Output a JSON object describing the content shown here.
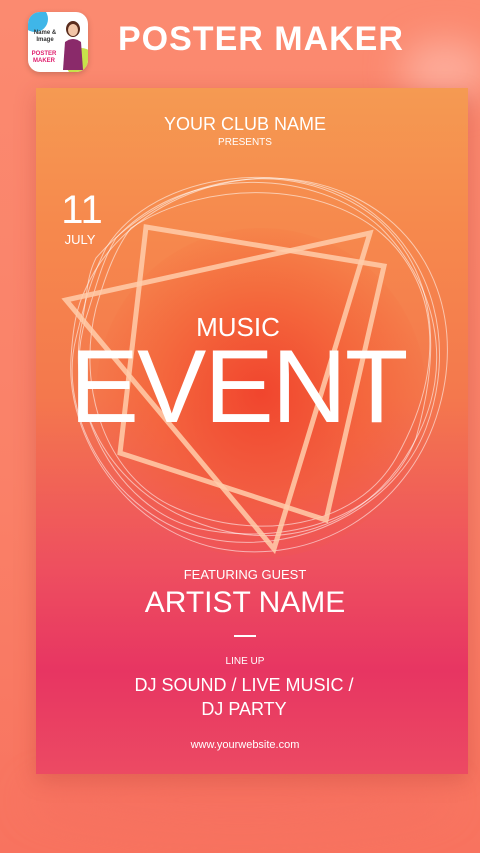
{
  "header": {
    "app_icon": {
      "name_image_text": "Name & Image",
      "poster_maker_text": "POSTER MAKER"
    },
    "title": "POSTER MAKER"
  },
  "poster": {
    "club_name": "YOUR CLUB NAME",
    "presents": "PRESENTS",
    "date_day": "11",
    "date_month": "JULY",
    "music": "MUSIC",
    "event": "EVENT",
    "featuring": "FEATURING GUEST",
    "artist": "ARTIST NAME",
    "lineup_label": "LINE UP",
    "acts": "DJ SOUND / LIVE MUSIC / DJ PARTY",
    "website": "www.yourwebsite.com"
  },
  "colors": {
    "background": "#fa8168",
    "poster_top": "#f59a52",
    "poster_bottom": "#e73562",
    "text": "#ffffff"
  }
}
